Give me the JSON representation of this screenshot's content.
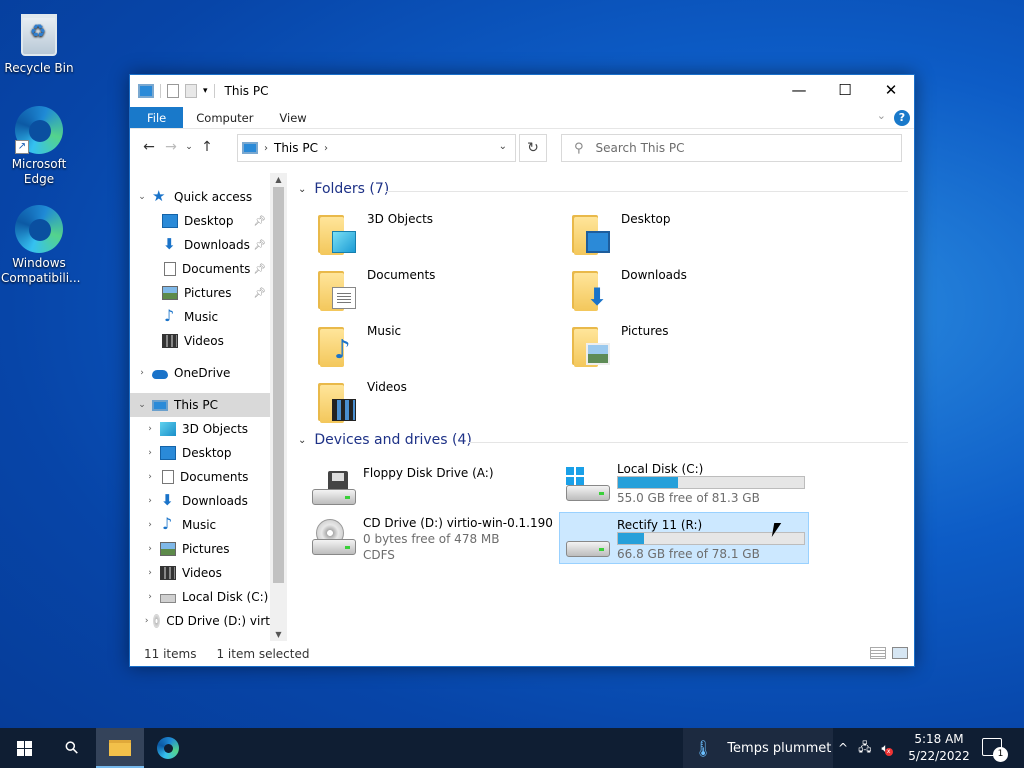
{
  "desktop": {
    "icons": [
      {
        "label": "Recycle Bin"
      },
      {
        "label": "Microsoft Edge"
      },
      {
        "label": "Windows Compatibili..."
      }
    ]
  },
  "window": {
    "title": "This PC",
    "ribbon_tabs": [
      "File",
      "Computer",
      "View"
    ],
    "address_path": "This PC",
    "search_placeholder": "Search This PC",
    "accent_color": "#1979ca"
  },
  "nav": {
    "items": [
      {
        "label": "Quick access",
        "icon": "star-icon"
      },
      {
        "label": "Desktop",
        "icon": "desktop-icon"
      },
      {
        "label": "Downloads",
        "icon": "download-icon"
      },
      {
        "label": "Documents",
        "icon": "document-icon"
      },
      {
        "label": "Pictures",
        "icon": "pictures-icon"
      },
      {
        "label": "Music",
        "icon": "music-icon"
      },
      {
        "label": "Videos",
        "icon": "video-icon"
      },
      {
        "label": "OneDrive",
        "icon": "cloud-icon"
      },
      {
        "label": "This PC",
        "icon": "computer-icon"
      },
      {
        "label": "3D Objects",
        "icon": "cube-icon"
      },
      {
        "label": "Desktop",
        "icon": "desktop-icon"
      },
      {
        "label": "Documents",
        "icon": "document-icon"
      },
      {
        "label": "Downloads",
        "icon": "download-icon"
      },
      {
        "label": "Music",
        "icon": "music-icon"
      },
      {
        "label": "Pictures",
        "icon": "pictures-icon"
      },
      {
        "label": "Videos",
        "icon": "video-icon"
      },
      {
        "label": "Local Disk (C:)",
        "icon": "disk-icon"
      },
      {
        "label": "CD Drive (D:) virt",
        "icon": "cd-icon"
      }
    ]
  },
  "folders": {
    "header": "Folders (7)",
    "items": [
      {
        "label": "3D Objects",
        "icon": "3d-objects-folder-icon"
      },
      {
        "label": "Desktop",
        "icon": "desktop-folder-icon"
      },
      {
        "label": "Documents",
        "icon": "documents-folder-icon"
      },
      {
        "label": "Downloads",
        "icon": "downloads-folder-icon"
      },
      {
        "label": "Music",
        "icon": "music-folder-icon"
      },
      {
        "label": "Pictures",
        "icon": "pictures-folder-icon"
      },
      {
        "label": "Videos",
        "icon": "videos-folder-icon"
      }
    ]
  },
  "drives": {
    "header": "Devices and drives (4)",
    "items": [
      {
        "label": "Floppy Disk Drive (A:)",
        "icon": "floppy-drive-icon"
      },
      {
        "label": "Local Disk (C:)",
        "icon": "windows-disk-icon",
        "free": "55.0 GB free of 81.3 GB",
        "used_fraction": 0.32
      },
      {
        "label": "CD Drive (D:) virtio-win-0.1.190",
        "icon": "cd-drive-icon",
        "line2": "0 bytes free of 478 MB",
        "line3": "CDFS"
      },
      {
        "label": "Rectify 11 (R:)",
        "icon": "disk-icon",
        "free": "66.8 GB free of 78.1 GB",
        "used_fraction": 0.14
      }
    ]
  },
  "status": {
    "count": "11 items",
    "selection": "1 item selected"
  },
  "taskbar": {
    "weather": "Temps plummet",
    "time": "5:18 AM",
    "date": "5/22/2022",
    "notifications": "1"
  }
}
